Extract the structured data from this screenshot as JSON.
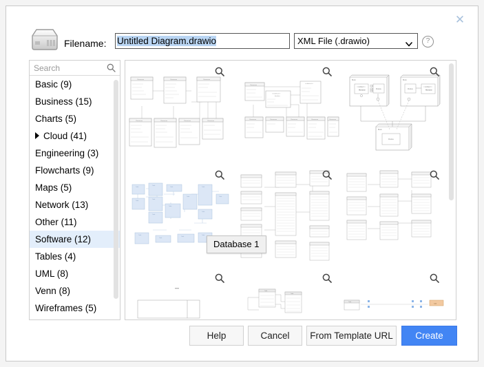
{
  "dialog": {
    "close_label": "✕",
    "close_icon": "close-icon"
  },
  "header": {
    "drive_icon": "hard-drive-icon",
    "filename_label": "Filename:",
    "filename_value": "Untitled Diagram.drawio",
    "filename_placeholder": "Untitled Diagram.drawio",
    "filetype_value": "XML File (.drawio)",
    "filetype_options": [
      "XML File (.drawio)"
    ],
    "help_icon": "question-mark-icon",
    "help_label": "?"
  },
  "sidebar": {
    "search_placeholder": "Search",
    "search_icon": "search-icon",
    "selected": "Software (12)",
    "items": [
      {
        "label": "Basic (9)",
        "expandable": false,
        "selected": false
      },
      {
        "label": "Business (15)",
        "expandable": false,
        "selected": false
      },
      {
        "label": "Charts (5)",
        "expandable": false,
        "selected": false
      },
      {
        "label": "Cloud (41)",
        "expandable": true,
        "selected": false
      },
      {
        "label": "Engineering (3)",
        "expandable": false,
        "selected": false
      },
      {
        "label": "Flowcharts (9)",
        "expandable": false,
        "selected": false
      },
      {
        "label": "Maps (5)",
        "expandable": false,
        "selected": false
      },
      {
        "label": "Network (13)",
        "expandable": false,
        "selected": false
      },
      {
        "label": "Other (11)",
        "expandable": false,
        "selected": false
      },
      {
        "label": "Software (12)",
        "expandable": false,
        "selected": true
      },
      {
        "label": "Tables (4)",
        "expandable": false,
        "selected": false
      },
      {
        "label": "UML (8)",
        "expandable": false,
        "selected": false
      },
      {
        "label": "Venn (8)",
        "expandable": false,
        "selected": false
      },
      {
        "label": "Wireframes (5)",
        "expandable": false,
        "selected": false
      }
    ]
  },
  "templates": {
    "zoom_icon": "magnifier-icon",
    "tooltip": "Database 1",
    "rows": 3,
    "columns": 3
  },
  "footer": {
    "help_label": "Help",
    "cancel_label": "Cancel",
    "url_label": "From Template URL",
    "create_label": "Create"
  },
  "colors": {
    "accent": "#4285f4",
    "selection": "#b9d5f3",
    "selected_row": "#e3eefb",
    "border": "#cfcfcf",
    "tooltip_bg": "#f0f0f0"
  }
}
